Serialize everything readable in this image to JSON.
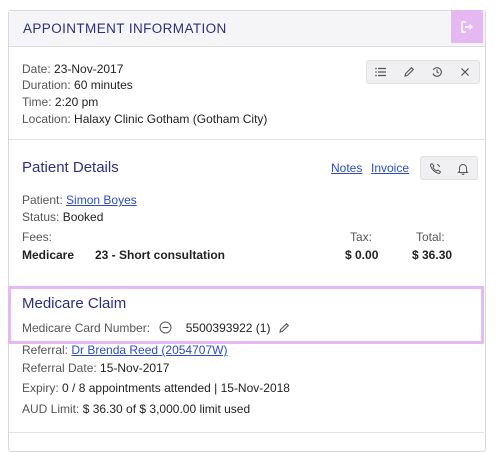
{
  "header": {
    "title": "APPOINTMENT INFORMATION",
    "exit_icon": "exit-icon"
  },
  "appointment": {
    "date_label": "Date:",
    "date": "23-Nov-2017",
    "duration_label": "Duration:",
    "duration": "60 minutes",
    "time_label": "Time:",
    "time": "2:20 pm",
    "location_label": "Location:",
    "location": "Halaxy Clinic Gotham (Gotham City)",
    "toolbar_icons": [
      "list-icon",
      "pencil-icon",
      "history-icon",
      "close-icon"
    ]
  },
  "patient": {
    "title": "Patient Details",
    "notes_link": "Notes",
    "invoice_link": "Invoice",
    "patient_label": "Patient:",
    "patient_name": "Simon Boyes",
    "status_label": "Status:",
    "status": "Booked",
    "fees_label": "Fees:",
    "tax_label": "Tax:",
    "total_label": "Total:",
    "fee_row": {
      "payer": "Medicare",
      "item": "23 - Short consultation",
      "tax": "$ 0.00",
      "total": "$ 36.30"
    },
    "toolbar_icons": [
      "phone-icon",
      "bell-icon"
    ]
  },
  "referral": {
    "referral_label": "Referral:",
    "referral_value": "Dr Brenda Reed (2054707W)",
    "date_label": "Referral Date:",
    "date": "15-Nov-2017",
    "expiry_label": "Expiry:",
    "expiry": "0 / 8 appointments attended | 15-Nov-2018",
    "limit_label": "AUD Limit:",
    "limit": "$ 36.30 of $ 3,000.00 limit used"
  },
  "medicare_claim": {
    "title": "Medicare Claim",
    "card_label": "Medicare Card Number:",
    "card_number": "5500393922 (1)"
  },
  "colors": {
    "accent": "#e7b8f3",
    "title": "#2d2f7e",
    "link": "#2b4cc8"
  }
}
